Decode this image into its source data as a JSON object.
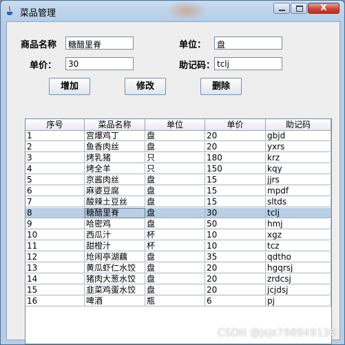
{
  "window": {
    "title": "菜品管理",
    "controls": {
      "close_symbol": "X"
    }
  },
  "form": {
    "name_label": "商品名称",
    "name_value": "糖醋里脊",
    "unit_label": "单位：",
    "unit_value": "盘",
    "price_label": "单价：",
    "price_value": "30",
    "code_label": "助记码：",
    "code_value": "tclj"
  },
  "buttons": {
    "add": "增加",
    "edit": "修改",
    "delete": "删除"
  },
  "table": {
    "columns": [
      "序号",
      "菜品名称",
      "单位",
      "单价",
      "助记码"
    ],
    "selected_index": 7,
    "rows": [
      [
        "1",
        "宫爆鸡丁",
        "盘",
        "20",
        "gbjd"
      ],
      [
        "2",
        "鱼香肉丝",
        "盘",
        "20",
        "yxrs"
      ],
      [
        "3",
        "烤乳猪",
        "只",
        "180",
        "krz"
      ],
      [
        "4",
        "烤全羊",
        "只",
        "150",
        "kqy"
      ],
      [
        "5",
        "京酱肉丝",
        "盘",
        "15",
        "jjrs"
      ],
      [
        "6",
        "麻婆豆腐",
        "盘",
        "15",
        "mpdf"
      ],
      [
        "7",
        "酸辣土豆丝",
        "盘",
        "15",
        "sltds"
      ],
      [
        "8",
        "糖醋里脊",
        "盘",
        "30",
        "tclj"
      ],
      [
        "9",
        "哈密鸡",
        "盘",
        "50",
        "hmj"
      ],
      [
        "10",
        "西瓜汁",
        "杯",
        "10",
        "xgz"
      ],
      [
        "11",
        "甜橙汁",
        "杯",
        "10",
        "tcz"
      ],
      [
        "12",
        "炝闹亭湖藕",
        "盘",
        "35",
        "qdtho"
      ],
      [
        "13",
        "黄瓜虾仁水饺",
        "盘",
        "20",
        "hgqrsj"
      ],
      [
        "14",
        "猪肉大葱水饺",
        "盘",
        "20",
        "zrdcsj"
      ],
      [
        "15",
        "韭菜鸡蛋水饺",
        "盘",
        "20",
        "jcjdsj"
      ],
      [
        "16",
        "啤酒",
        "瓶",
        "6",
        "pj"
      ]
    ]
  },
  "watermark": "CSDN @jsjs798949136"
}
